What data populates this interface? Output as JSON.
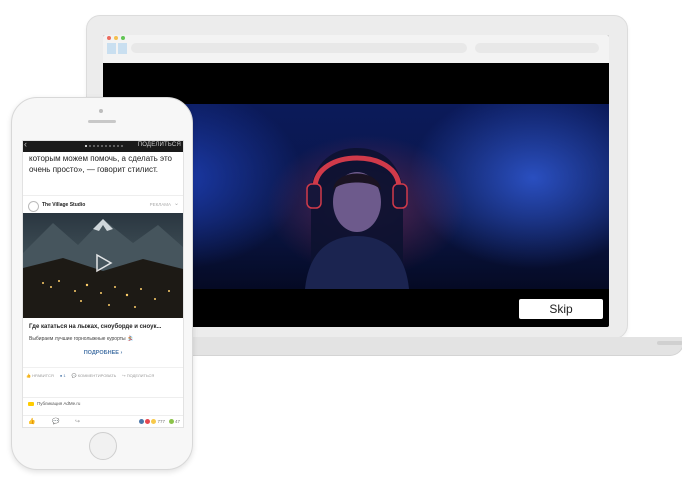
{
  "laptop": {
    "skip_label": "Skip"
  },
  "phone": {
    "top_bar": {
      "back_glyph": "‹",
      "share_label": "ПОДЕЛИТЬСЯ"
    },
    "article_text": "которым можем помочь, а сделать это очень просто», — говорит стилист.",
    "ad": {
      "brand": "The Village Studio",
      "tag": "РЕКЛАМА",
      "title": "Где кататься на лыжах, сноуборде и сноук...",
      "subtitle": "Выбираем лучшие горнолыжные курорты 🏂",
      "more_label": "ПОДРОБНЕЕ",
      "actions": {
        "like": "НРАВИТСЯ",
        "count": "1",
        "comment": "КОММЕНТИРОВАТЬ",
        "share": "ПОДЕЛИТЬСЯ"
      }
    },
    "publication": "Публикация AdMe.ru",
    "bottom": {
      "reactions_count": "777",
      "comments_count": "47"
    }
  },
  "colors": {
    "accent": "#4a76a8",
    "reaction_like": "#4a76a8",
    "reaction_love": "#e6474f",
    "reaction_haha": "#f7c94a"
  }
}
